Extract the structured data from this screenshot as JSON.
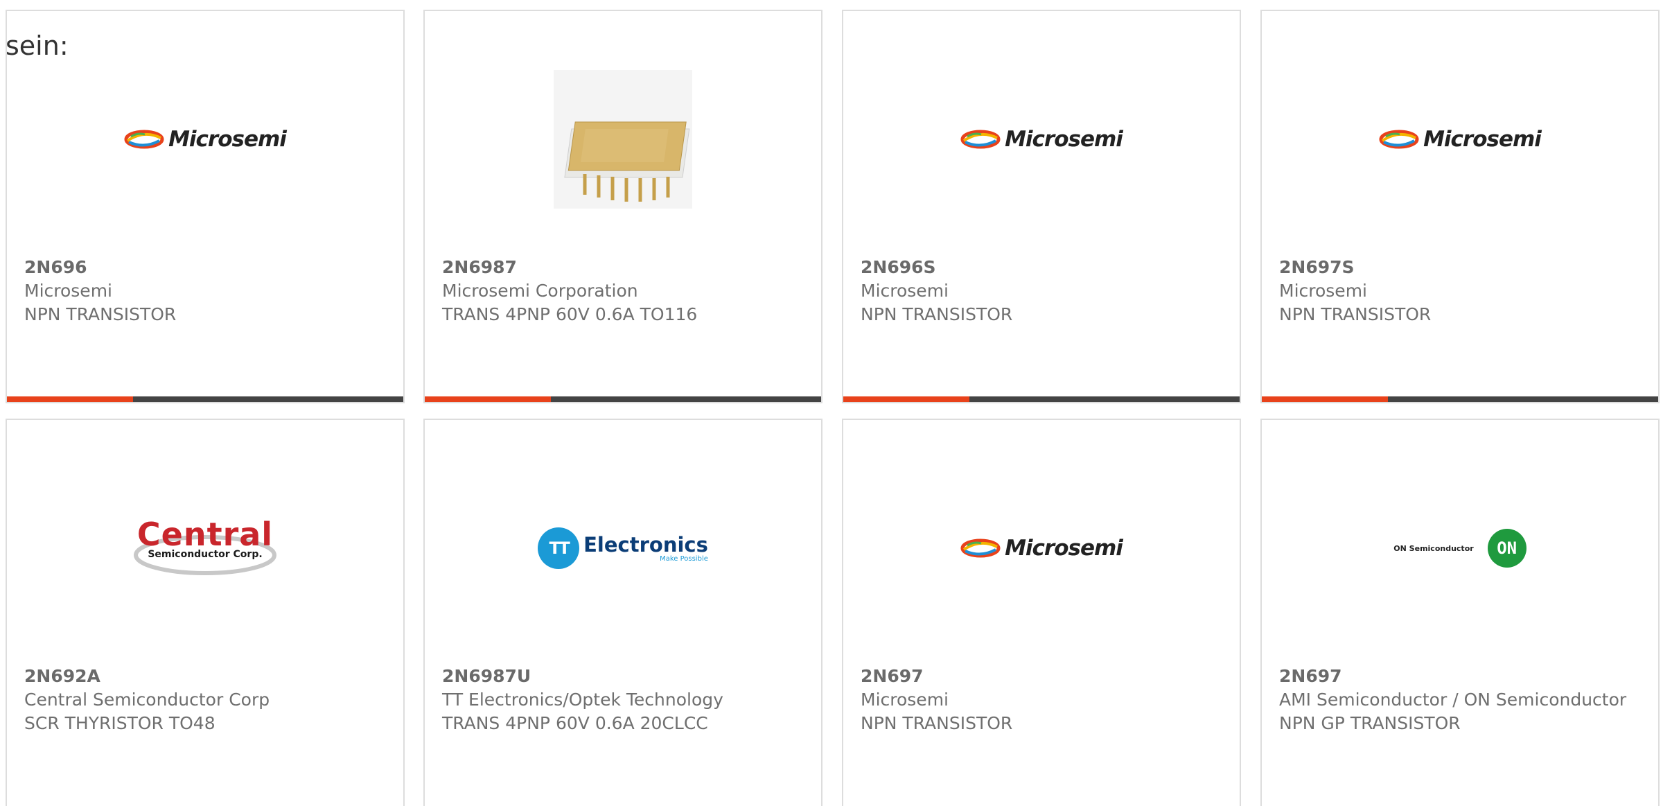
{
  "intro_text": "sein:",
  "colors": {
    "accent": "#e8421b",
    "bar_rest": "#444444",
    "card_border": "#dddddd",
    "text": "#6f6f6f"
  },
  "brand_logos": {
    "microsemi": "Microsemi",
    "central_main": "Central",
    "central_sub": "Semiconductor Corp.",
    "tt_brand": "Electronics",
    "tt_mark": "TT",
    "tt_tagline": "Make Possible",
    "on_text": "ON Semiconductor",
    "on_mark": "ON"
  },
  "products": [
    {
      "part_number": "2N696",
      "manufacturer": "Microsemi",
      "description": "NPN TRANSISTOR",
      "logo": "microsemi-logo",
      "progress": 0.31
    },
    {
      "part_number": "2N6987",
      "manufacturer": "Microsemi Corporation",
      "description": "TRANS 4PNP 60V 0.6A TO116",
      "logo": "chip-image",
      "progress": 0.31
    },
    {
      "part_number": "2N696S",
      "manufacturer": "Microsemi",
      "description": "NPN TRANSISTOR",
      "logo": "microsemi-logo",
      "progress": 0.31
    },
    {
      "part_number": "2N697S",
      "manufacturer": "Microsemi",
      "description": "NPN TRANSISTOR",
      "logo": "microsemi-logo",
      "progress": 0.31
    },
    {
      "part_number": "2N692A",
      "manufacturer": "Central Semiconductor Corp",
      "description": "SCR THYRISTOR TO48",
      "logo": "central-logo"
    },
    {
      "part_number": "2N6987U",
      "manufacturer": "TT Electronics/Optek Technology",
      "description": "TRANS 4PNP 60V 0.6A 20CLCC",
      "logo": "tt-electronics-logo"
    },
    {
      "part_number": "2N697",
      "manufacturer": "Microsemi",
      "description": "NPN TRANSISTOR",
      "logo": "microsemi-logo"
    },
    {
      "part_number": "2N697",
      "manufacturer": "AMI Semiconductor / ON Semiconductor",
      "description": "NPN GP TRANSISTOR",
      "logo": "on-semiconductor-logo"
    }
  ]
}
